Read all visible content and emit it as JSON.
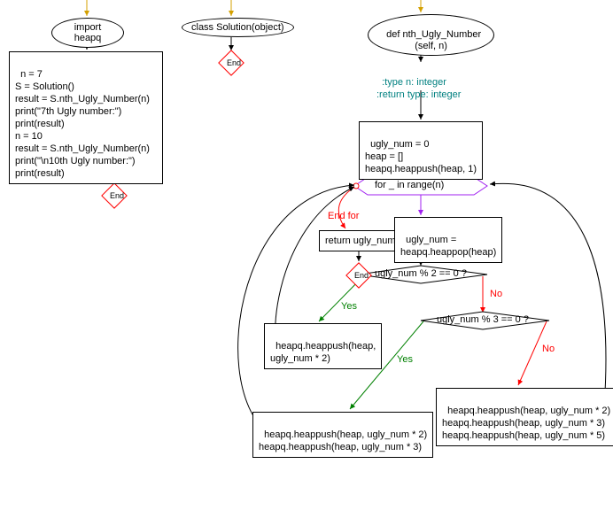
{
  "left": {
    "ellipse": "import heapq",
    "code": "n = 7\nS = Solution()\nresult = S.nth_Ugly_Number(n)\nprint(\"7th Ugly number:\")\nprint(result)\nn = 10\nresult = S.nth_Ugly_Number(n)\nprint(\"\\n10th Ugly number:\")\nprint(result)",
    "end": "End"
  },
  "mid": {
    "ellipse": "class Solution(object)",
    "end": "End"
  },
  "right": {
    "ellipse": "def nth_Ugly_Number\n(self, n)",
    "docstring": ":type n: integer\n:return type: integer",
    "init": "ugly_num = 0\nheap = []\nheapq.heappush(heap, 1)",
    "loop": "for _ in range(n)",
    "endfor": "End for",
    "ret": "return ugly_num",
    "end": "End",
    "pop": "ugly_num =\nheapq.heappop(heap)",
    "cond1": "ugly_num % 2 == 0 ?",
    "cond2": "ugly_num % 3 == 0 ?",
    "push2": "heapq.heappush(heap,\nugly_num * 2)",
    "push23": "heapq.heappush(heap, ugly_num * 2)\nheapq.heappush(heap, ugly_num * 3)",
    "push235": "heapq.heappush(heap, ugly_num * 2)\nheapq.heappush(heap, ugly_num * 3)\nheapq.heappush(heap, ugly_num * 5)",
    "yes": "Yes",
    "no": "No"
  }
}
